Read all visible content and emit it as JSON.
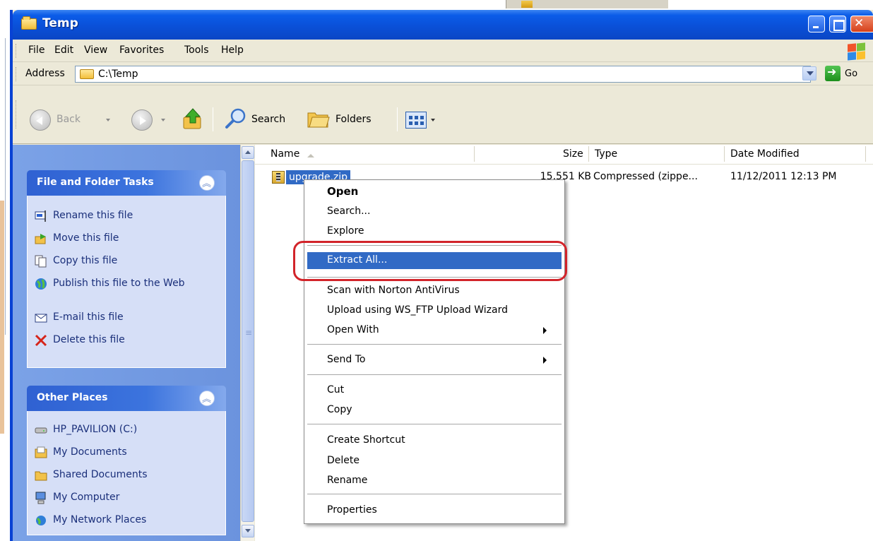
{
  "window": {
    "title": "Temp"
  },
  "menu": [
    "File",
    "Edit",
    "View",
    "Favorites",
    "Tools",
    "Help"
  ],
  "address": {
    "label": "Address",
    "path": "C:\\Temp",
    "go_label": "Go"
  },
  "toolbar": {
    "back": "Back",
    "search": "Search",
    "folders": "Folders"
  },
  "task_panel": {
    "file_tasks": {
      "title": "File and Folder Tasks",
      "items": [
        "Rename this file",
        "Move this file",
        "Copy this file",
        "Publish this file to the Web",
        "E-mail this file",
        "Delete this file"
      ]
    },
    "other_places": {
      "title": "Other Places",
      "items": [
        "HP_PAVILION (C:)",
        "My Documents",
        "Shared Documents",
        "My Computer",
        "My Network Places"
      ]
    }
  },
  "file_list": {
    "columns": [
      "Name",
      "Size",
      "Type",
      "Date Modified"
    ],
    "rows": [
      {
        "name": "upgrade.zip",
        "size": "15,551 KB",
        "type": "Compressed (zippe...",
        "date": "11/12/2011 12:13 PM"
      }
    ]
  },
  "context_menu": [
    "Open",
    "Search...",
    "Explore",
    "Extract All...",
    "Scan with Norton AntiVirus",
    "Upload using WS_FTP Upload Wizard",
    "Open With",
    "Send To",
    "Cut",
    "Copy",
    "Create Shortcut",
    "Delete",
    "Rename",
    "Properties"
  ],
  "colors": {
    "title_bar": "#0a50d8",
    "selection": "#316ac5",
    "highlight_outline": "#d2242a",
    "task_pane": "#7ba2e7"
  }
}
